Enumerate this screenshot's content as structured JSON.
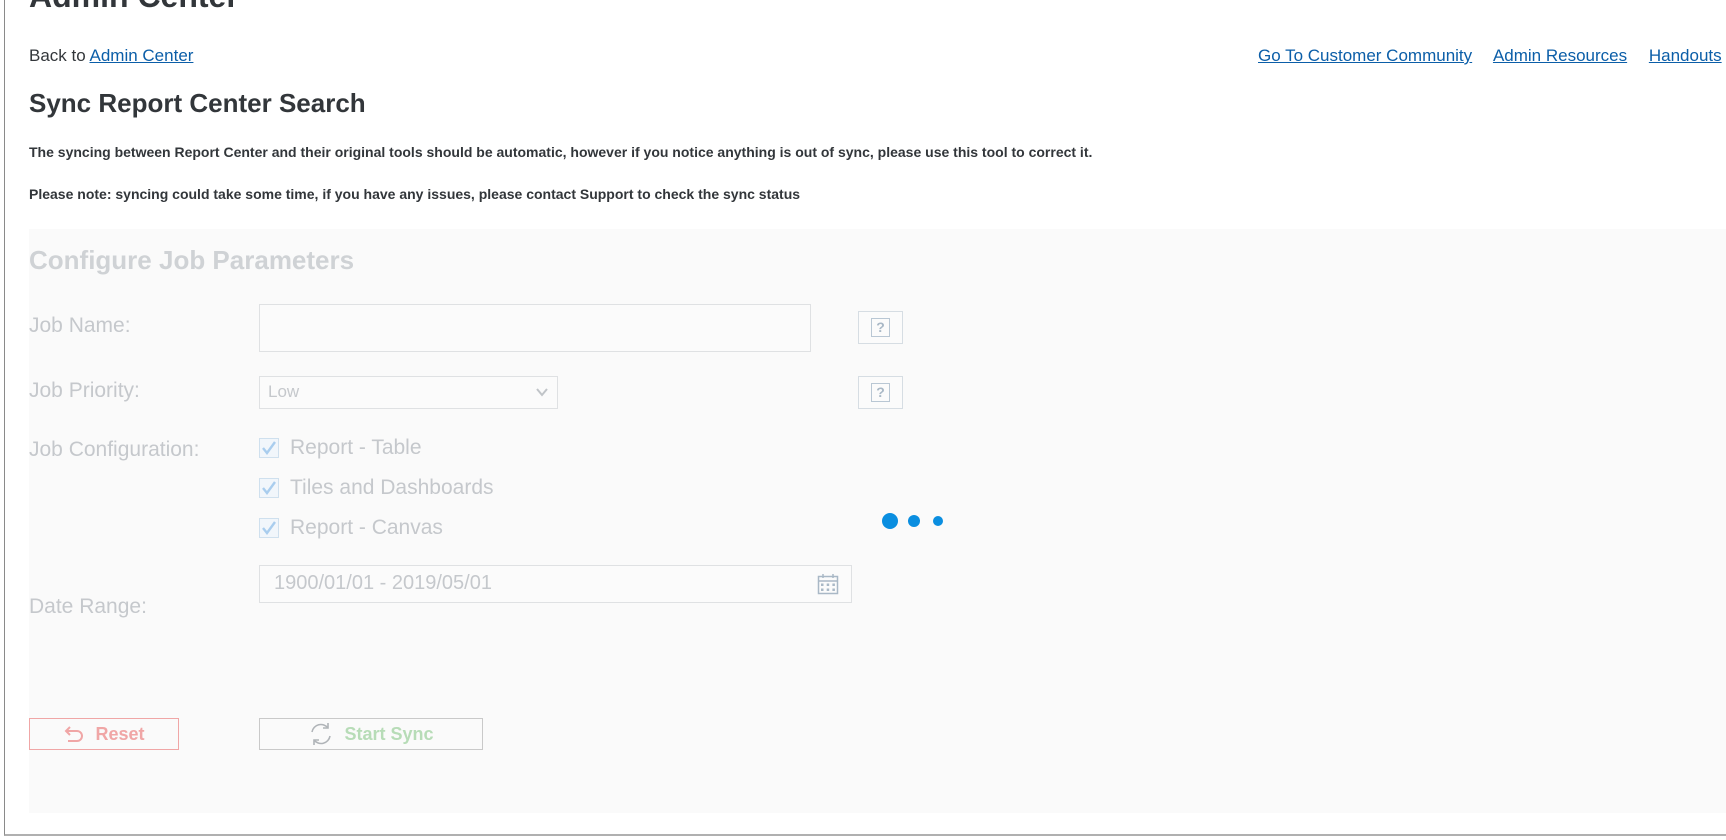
{
  "header": {
    "app_title": "Admin Center",
    "back_prefix": "Back to",
    "back_link": "Admin Center",
    "links": [
      "Go To Customer Community",
      "Admin Resources",
      "Handouts"
    ]
  },
  "page": {
    "title": "Sync Report Center Search",
    "description": "The syncing between Report Center and their original tools should be automatic, however if you notice anything is out of sync, please use this tool to correct it.",
    "note": "Please note: syncing could take some time, if you have any issues, please contact Support to check the sync status"
  },
  "form": {
    "title": "Configure Job Parameters",
    "job_name_label": "Job Name:",
    "job_name_value": "",
    "job_priority_label": "Job Priority:",
    "job_priority_value": "Low",
    "job_configuration_label": "Job Configuration:",
    "configurations": [
      {
        "label": "Report - Table",
        "checked": true
      },
      {
        "label": "Tiles and Dashboards",
        "checked": true
      },
      {
        "label": "Report - Canvas",
        "checked": true
      }
    ],
    "date_range_label": "Date Range:",
    "date_range_value": "1900/01/01 - 2019/05/01",
    "reset_label": "Reset",
    "start_sync_label": "Start Sync"
  },
  "icons": {
    "help": "help-icon",
    "dropdown": "chevron-down-icon",
    "calendar": "calendar-icon",
    "reset": "undo-icon",
    "sync": "refresh-icon",
    "busy": "loading-indicator"
  },
  "colors": {
    "link": "#0b5ea8",
    "busy_indicator": "#0a8ee0",
    "reset_disabled": "#f0a6a6",
    "sync_disabled": "#b7dcb7"
  }
}
